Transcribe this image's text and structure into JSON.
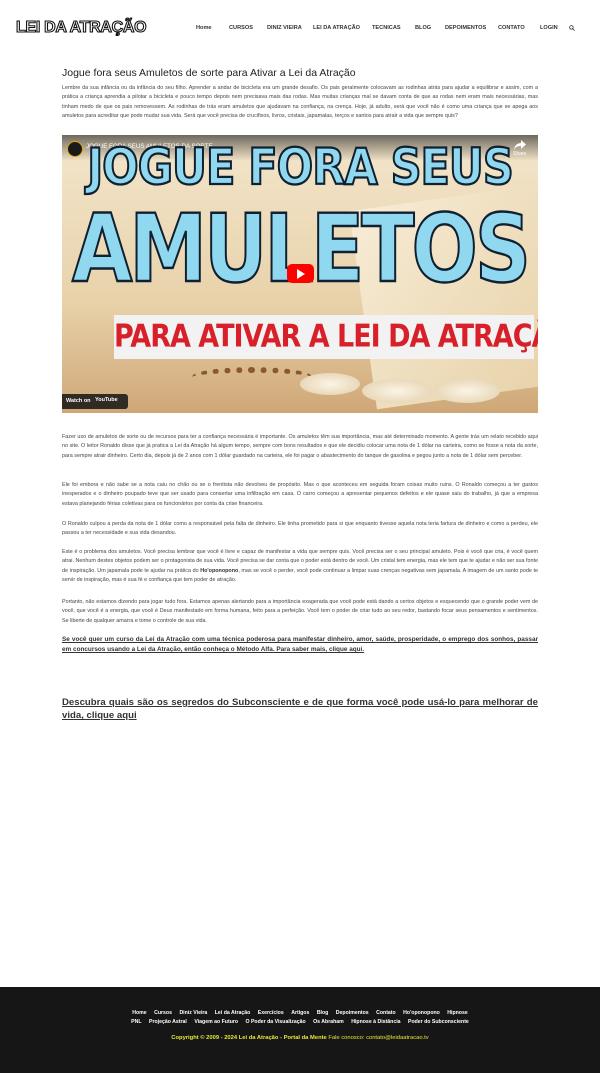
{
  "header": {
    "logo": "LEI DA ATRAÇÃO",
    "nav": [
      "Home",
      "CURSOS",
      "DINIZ VIEIRA",
      "LEI DA ATRAÇÃO",
      "TECNICAS",
      "BLOG",
      "DEPOIMENTOS",
      "CONTATO",
      "LOGIN"
    ],
    "search_icon": "search-icon"
  },
  "article": {
    "title": "Jogue fora seus Amuletos de sorte para Ativar a Lei da Atração",
    "p1": "Lembre da sua infância ou da infância do seu filho. Aprender a andar de bicicleta era um grande desafio. Os pais geralmente colocavam as rodinhas atrás para ajudar a equilibrar e assim, com a prática a criança aprendia a pilotar a bicicleta e pouco tempo depois nem precisava mais das rodas. Mas muitas crianças mal se davam conta de que as rodas nem eram mais necessárias, mas tinham medo de que os pais removessem. As rodinhas de trás eram amuletos que ajudavam na confiança, na crença. Hoje, já adulto, será que você não é como uma criança que se apega aos amuletos para acreditar que pode mudar sua vida. Será que você precisa de crucifixos, livros, cristais, japamalas, terços e santos para atrair a vida que sempre quis?",
    "video": {
      "title": "JOGUE FORA SEUS AMULETOS DA SORTE",
      "share": "Share",
      "thumb_line1": "JOGUE FORA SEUS",
      "thumb_line2": "AMULETOS",
      "thumb_line3": "PARA ATIVAR A LEI DA ATRAÇÃO",
      "watch_on": "Watch on",
      "youtube": "YouTube"
    },
    "p2": "Fazer uso de amuletos de sorte ou de recursos para ter a confiança necessária é importante. Os amuletos têm sua importância, mas até determinado momento. A gente trás um relato recebido aqui no site. O leitor Ronaldo disse que já pratica a Lei da Atração há algum tempo, sempre com bons resultados e que ele decidiu colocar uma nota de 1 dólar na carteira, como se fosse a nota da sorte, para sempre atrair dinheiro. Certo dia, depois já de 2 anos com 1 dólar guardado na carteira, ele foi pagar o abastecimento do tanque de gasolina e pegou junto a nota de 1 dólar sem perceber.",
    "p3": "Ele foi embora e não sabe se a nota caiu no chão ou se o frentista não devolveu de propósito. Mas o que aconteceu em seguida foram coisas muito ruins. O Ronaldo começou a ter gastos inesperados e o dinheiro poupado teve que ser usado para consertar uma infiltração em casa. O carro começou a apresentar pequenos defeitos e ele quase saiu do trabalho, já que a empresa estava planejando férias coletivas para os funcionários por conta da crise financeira.",
    "p4": "O Ronaldo culpou a perda da nota de 1 dólar como a responsável pela falta de dinheiro. Ele tinha prometido para si que enquanto tivesse aquela nota teria fartura de dinheiro e como a perdeu, ele passou a ter necessidade e sua vida desandou.",
    "p5a": "Este é o problema dos amuletos. Você precisa lembrar que você é livre e capaz de manifestar a vida que sempre quis. Você precisa ser o seu principal amuleto. Pois é você que cria, é você quem atrai. Nenhum destes objetos podem ser o protagonista de sua vida. Você precisa se dar conta que o poder está dentro de você. Um cristal tem energia, mas ele tem que te ajudar e não ser sua fonte de inspiração. Um japamala pode te ajudar na prática do ",
    "p5_link": "Ho'oponopono",
    "p5b": ", mas se você o perder, você pode continuar a limpar suas crenças negativas sem japamala. A imagem de um santo pode te servir de inspiração, mas é sua fé e confiança que tem poder de atração.",
    "p6": "Portanto, não estamos dizendo para jogar tudo fora. Estamos apenas alertando para a importância exagerada que você pode está dando a certos objetos e esquecendo que o grande poder vem de você, que você é a energia, que você é Deus manifestado em forma humana, feito para a perfeição. Você tem o poder de criar tudo ao seu redor, bastando focar seus pensamentos e sentimentos. Se liberte de qualquer amarra e tome o controle de sua vida.",
    "cta1": "Se você quer um curso da Lei da Atração com uma técnica poderosa para manifestar dinheiro, amor, saúde, prosperidade, o emprego dos sonhos, passar em concursos usando a Lei da Atração, então conheça o Método Alfa. Para saber mais, clique aqui.",
    "cta2": "Descubra quais são os segredos do Subconsciente e de que forma você pode usá-lo para melhorar de vida, clique aqui"
  },
  "footer": {
    "row1": [
      "Home",
      "Cursos",
      "Diniz Vieira",
      "Lei da Atração",
      "Exercícios",
      "Artigos",
      "Blog",
      "Depoimentos",
      "Contato",
      "Ho'oponopono",
      "Hipnose"
    ],
    "row2": [
      "PNL",
      "Projeção Astral",
      "Viagem ao Futuro",
      "O Poder da Visualização",
      "Os Abraham",
      "Hipnose à Distância",
      "Poder do Subconsciente"
    ],
    "copyright": "Copyright © 2009 - 2024 Lei da Atração - Portal da Mente",
    "contact": " Fale conosco: contato@leidaatracao.tv"
  }
}
